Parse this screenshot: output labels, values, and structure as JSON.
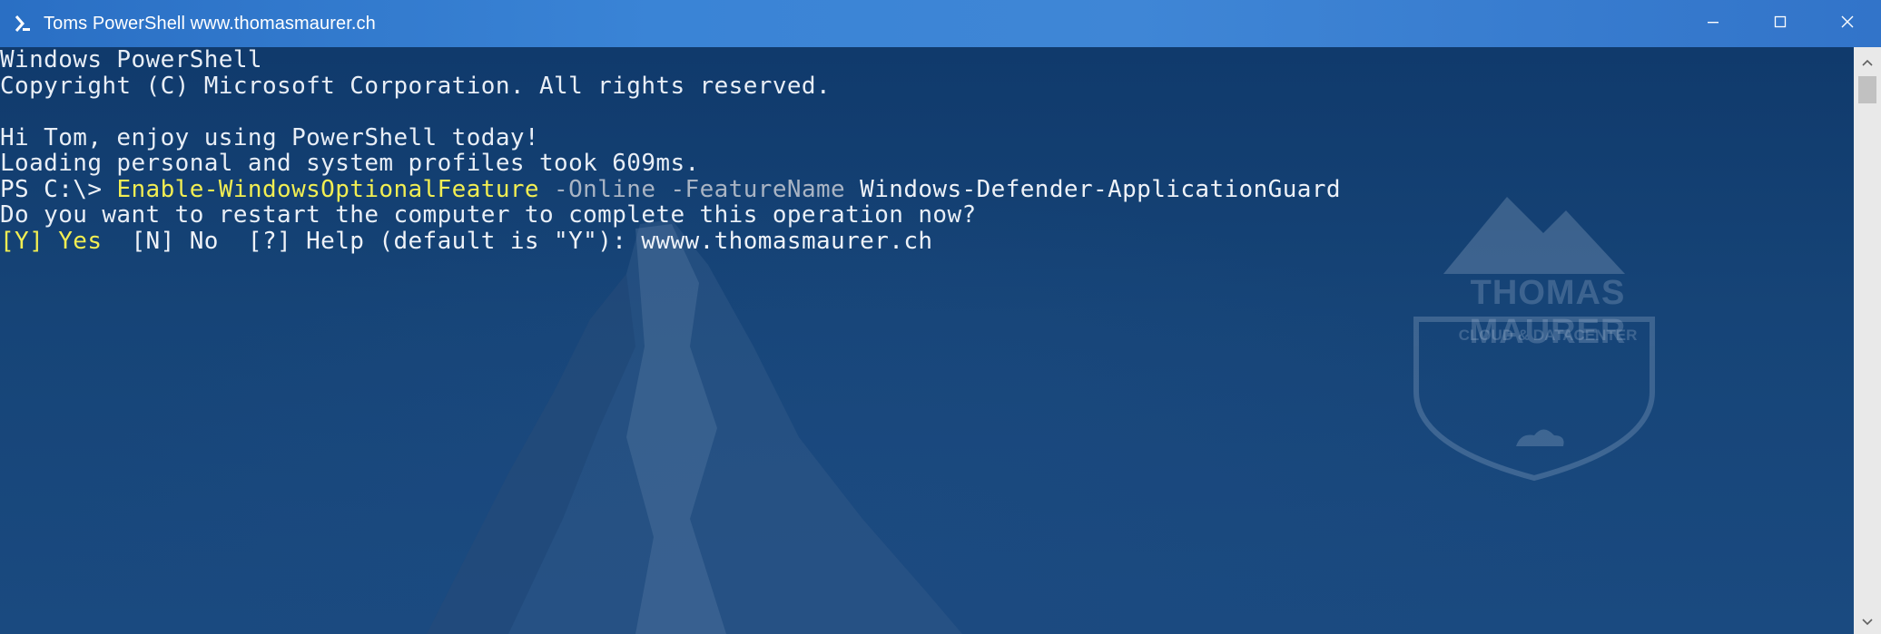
{
  "window": {
    "title": "Toms PowerShell www.thomasmaurer.ch",
    "icon": "powershell-icon",
    "title_bar_color": "#3a84d6"
  },
  "caption": {
    "minimize_icon": "minimize-icon",
    "maximize_icon": "maximize-icon",
    "close_icon": "close-icon"
  },
  "console": {
    "background_color": "#164477",
    "text_color": "#e8eef6",
    "highlight_color": "#f2ee52",
    "param_color": "#a9b4c4",
    "lines": {
      "l1": "Windows PowerShell",
      "l2": "Copyright (C) Microsoft Corporation. All rights reserved.",
      "l3": "",
      "l4": "Hi Tom, enjoy using PowerShell today!",
      "l5": "Loading personal and system profiles took 609ms.",
      "prompt": "PS C:\\> ",
      "cmdlet": "Enable-WindowsOptionalFeature",
      "params": " -Online -FeatureName",
      "arg": " Windows-Defender-ApplicationGuard",
      "l7": "Do you want to restart the computer to complete this operation now?",
      "choice_yes": "[Y] Yes",
      "choice_rest": "  [N] No  [?] Help (default is \"Y\"): ",
      "user_input": "wwww.thomasmaurer.ch"
    }
  },
  "watermark": {
    "line1": "THOMAS MAURER",
    "line2": "CLOUD & DATACENTER"
  },
  "scrollbar": {
    "up_icon": "arrow-up-icon",
    "down_icon": "arrow-down-icon"
  }
}
